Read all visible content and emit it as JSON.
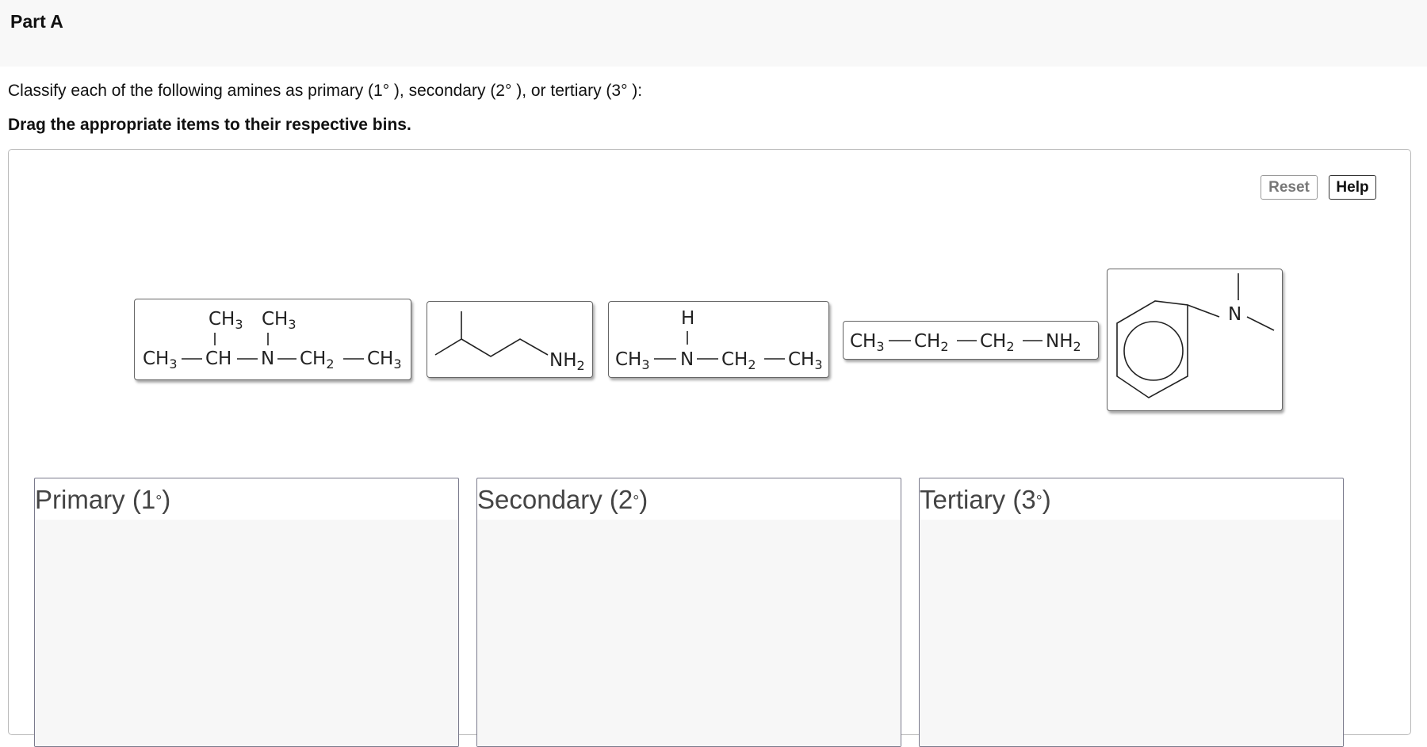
{
  "part": {
    "title": "Part A"
  },
  "prompt": {
    "instruction": "Classify each of the following amines as primary (1° ), secondary (2° ), or tertiary (3° ):",
    "drag_hint": "Drag the appropriate items to their respective bins."
  },
  "toolbar": {
    "reset_label": "Reset",
    "help_label": "Help"
  },
  "items": {
    "t1": {
      "ch3": "CH",
      "three": "3",
      "ch": "CH",
      "n": "N",
      "ch2": "CH",
      "two": "2"
    },
    "t2": {
      "nh": "NH",
      "two": "2"
    },
    "t3": {
      "h": "H",
      "ch3": "CH",
      "three": "3",
      "n": "N",
      "ch2": "CH",
      "two": "2"
    },
    "t4": {
      "ch3": "CH",
      "three": "3",
      "ch2": "CH",
      "two": "2",
      "nh": "NH"
    },
    "t5": {
      "n": "N"
    }
  },
  "bins": [
    {
      "label": "Primary (1",
      "deg": "°",
      "close": ")"
    },
    {
      "label": "Secondary (2",
      "deg": "°",
      "close": ")"
    },
    {
      "label": "Tertiary (3",
      "deg": "°",
      "close": ")"
    }
  ],
  "colors": {
    "header_bg": "#f8f8f8",
    "bin_border": "#7a7a8c",
    "tile_border": "#666666"
  }
}
